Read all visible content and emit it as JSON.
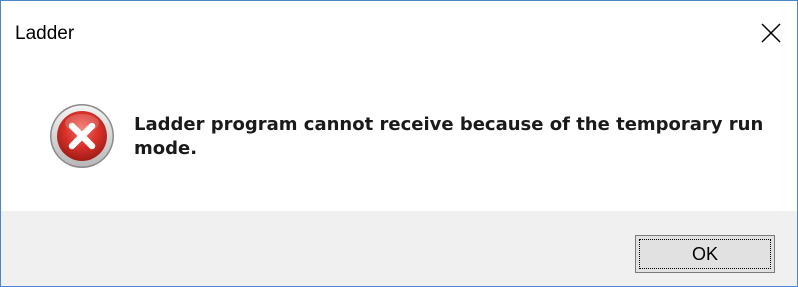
{
  "window": {
    "title": "Ladder"
  },
  "message": {
    "text": "Ladder program cannot receive because of the temporary run mode.",
    "icon": "error-icon"
  },
  "buttons": {
    "ok_label": "OK",
    "close_icon": "close-icon"
  },
  "colors": {
    "error_red": "#d8322b",
    "footer_bg": "#f0f0f0",
    "window_border": "#4a86c8",
    "button_bg": "#e1e1e1"
  }
}
